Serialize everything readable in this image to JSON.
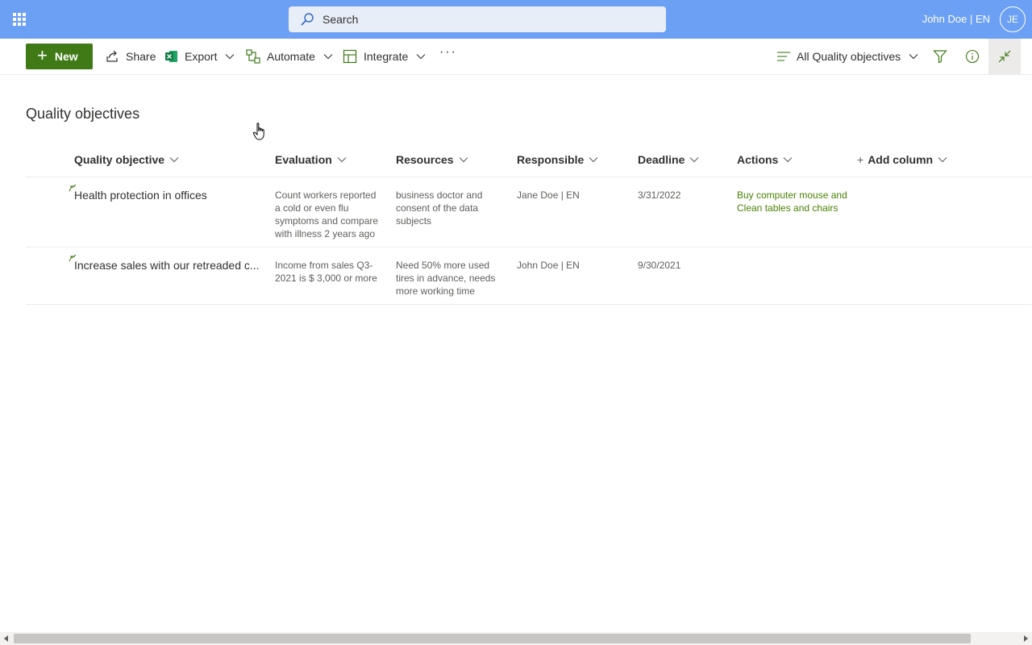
{
  "topbar": {
    "search_placeholder": "Search",
    "user_name": "John Doe | EN",
    "avatar_initials": "JE",
    "bar_color": "#6ca0f5"
  },
  "commandbar": {
    "new_label": "New",
    "share_label": "Share",
    "export_label": "Export",
    "automate_label": "Automate",
    "integrate_label": "Integrate",
    "more_label": "···",
    "view_label": "All Quality objectives",
    "accent_color": "#3f7a17"
  },
  "page": {
    "title": "Quality objectives"
  },
  "table": {
    "columns": [
      "Quality objective",
      "Evaluation",
      "Resources",
      "Responsible",
      "Deadline",
      "Actions"
    ],
    "add_column_label": "Add column",
    "rows": [
      {
        "objective": "Health protection in offices",
        "evaluation": "Count workers reported a cold or even flu symptoms and compare with illness 2 years ago",
        "resources": "business doctor and consent of the data subjects",
        "responsible": "Jane Doe | EN",
        "deadline": "3/31/2022",
        "actions": "Buy computer mouse and Clean tables and chairs"
      },
      {
        "objective": "Increase sales with our retreaded c...",
        "evaluation": "Income from sales Q3-2021 is $ 3,000 or more",
        "resources": "Need 50% more used tires in advance, needs more working time",
        "responsible": "John Doe | EN",
        "deadline": "9/30/2021",
        "actions": ""
      }
    ]
  }
}
